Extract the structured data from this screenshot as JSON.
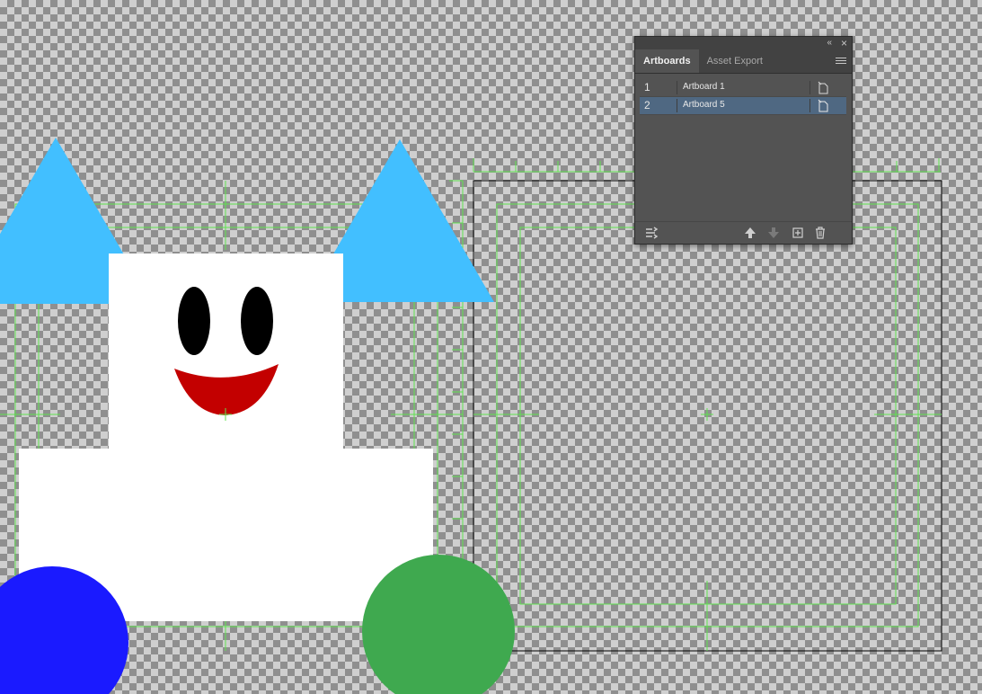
{
  "panel": {
    "collapse_glyph": "«",
    "close_glyph": "×",
    "tabs": [
      {
        "label": "Artboards",
        "active": true
      },
      {
        "label": "Asset Export",
        "active": false
      }
    ],
    "artboards": [
      {
        "number": "1",
        "name": "Artboard 1",
        "selected": false
      },
      {
        "number": "2",
        "name": "Artboard 5",
        "selected": true
      }
    ],
    "footer_buttons": [
      "rearrange-icon",
      "move-up-icon",
      "move-down-icon",
      "new-artboard-icon",
      "delete-icon"
    ]
  },
  "colors": {
    "checker_light": "#cfcfcf",
    "checker_dark": "#8f8f8f",
    "guide": "#5fe34f",
    "ear_blue": "#42bfff",
    "body_white": "#ffffff",
    "eye_black": "#000000",
    "mouth_red": "#c30000",
    "wheel_blue": "#1a1aff",
    "wheel_green": "#3fa94f",
    "selection_blue": "#4f6882"
  }
}
